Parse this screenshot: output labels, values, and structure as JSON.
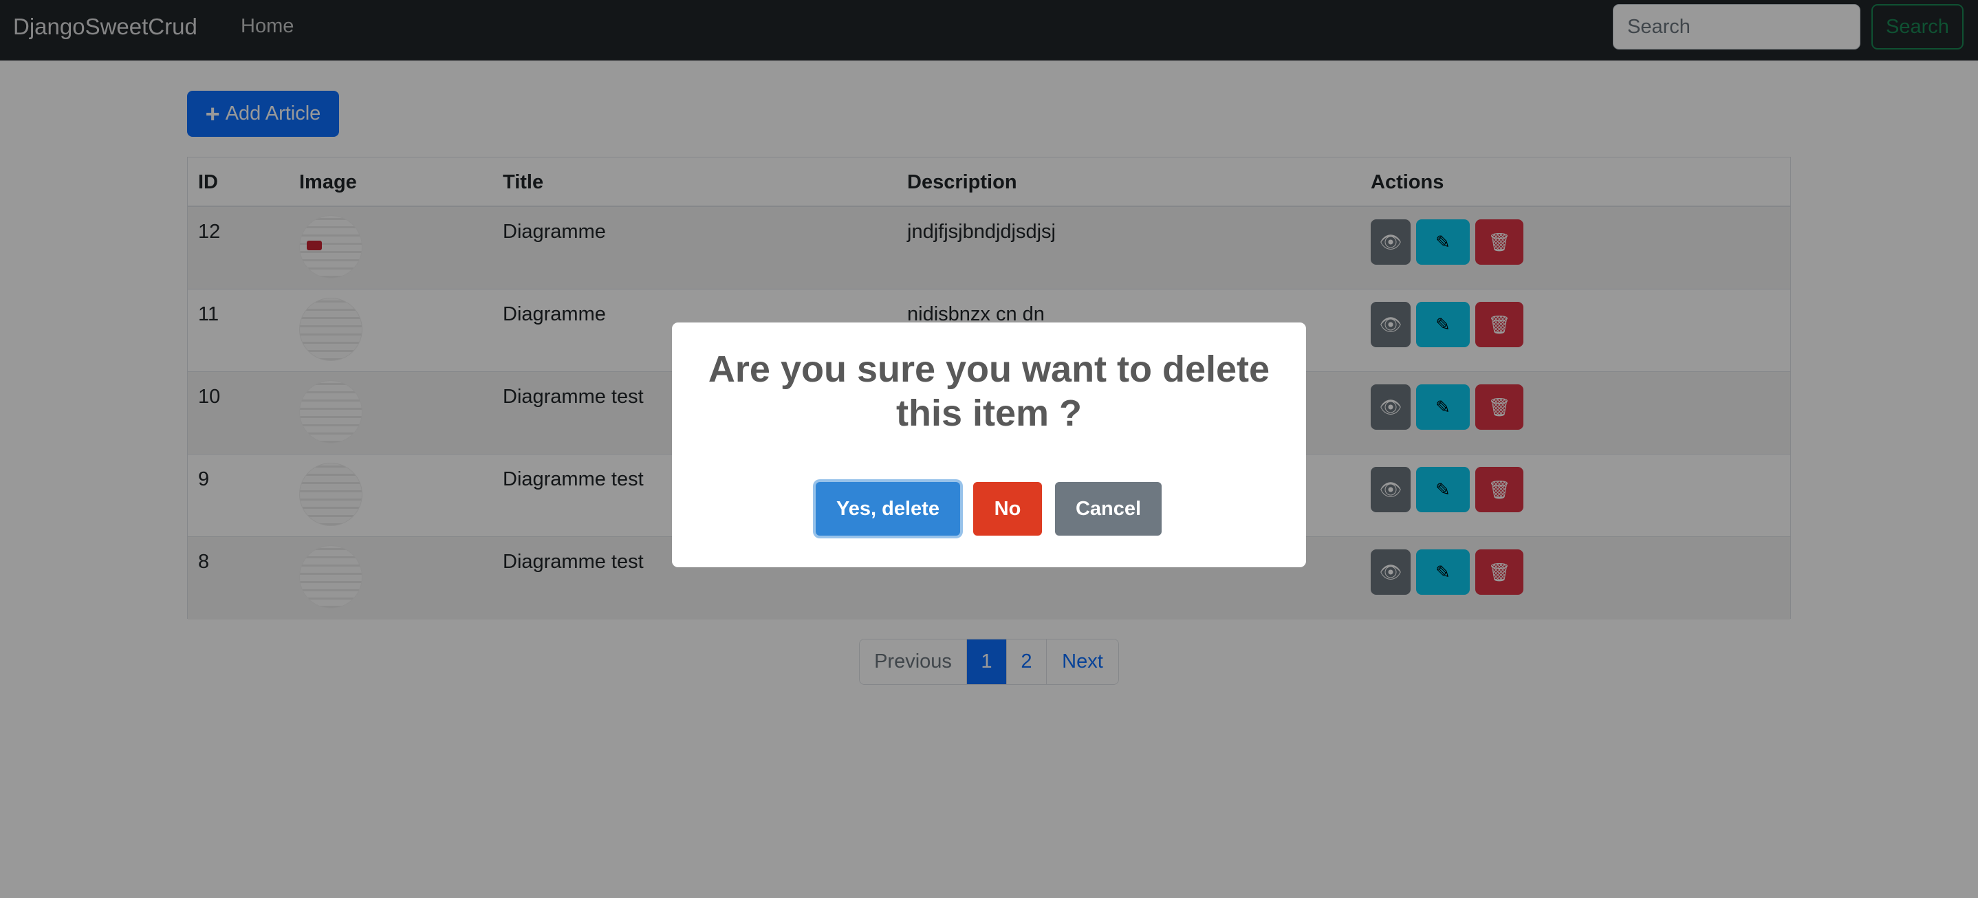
{
  "navbar": {
    "brand": "DjangoSweetCrud",
    "home": "Home",
    "search_placeholder": "Search",
    "search_button": "Search"
  },
  "toolbar": {
    "add_label": "Add Article"
  },
  "table": {
    "headers": {
      "id": "ID",
      "image": "Image",
      "title": "Title",
      "description": "Description",
      "actions": "Actions"
    },
    "rows": [
      {
        "id": "12",
        "title": "Diagramme",
        "description": "jndjfjsjbndjdjsdjsj"
      },
      {
        "id": "11",
        "title": "Diagramme",
        "description": "nidisbnzx cn dn"
      },
      {
        "id": "10",
        "title": "Diagramme test",
        "description": ""
      },
      {
        "id": "9",
        "title": "Diagramme test",
        "description": ""
      },
      {
        "id": "8",
        "title": "Diagramme test",
        "description": ""
      }
    ]
  },
  "pagination": {
    "previous": "Previous",
    "page1": "1",
    "page2": "2",
    "next": "Next"
  },
  "modal": {
    "title": "Are you sure you want to delete this item ?",
    "confirm": "Yes, delete",
    "deny": "No",
    "cancel": "Cancel"
  }
}
